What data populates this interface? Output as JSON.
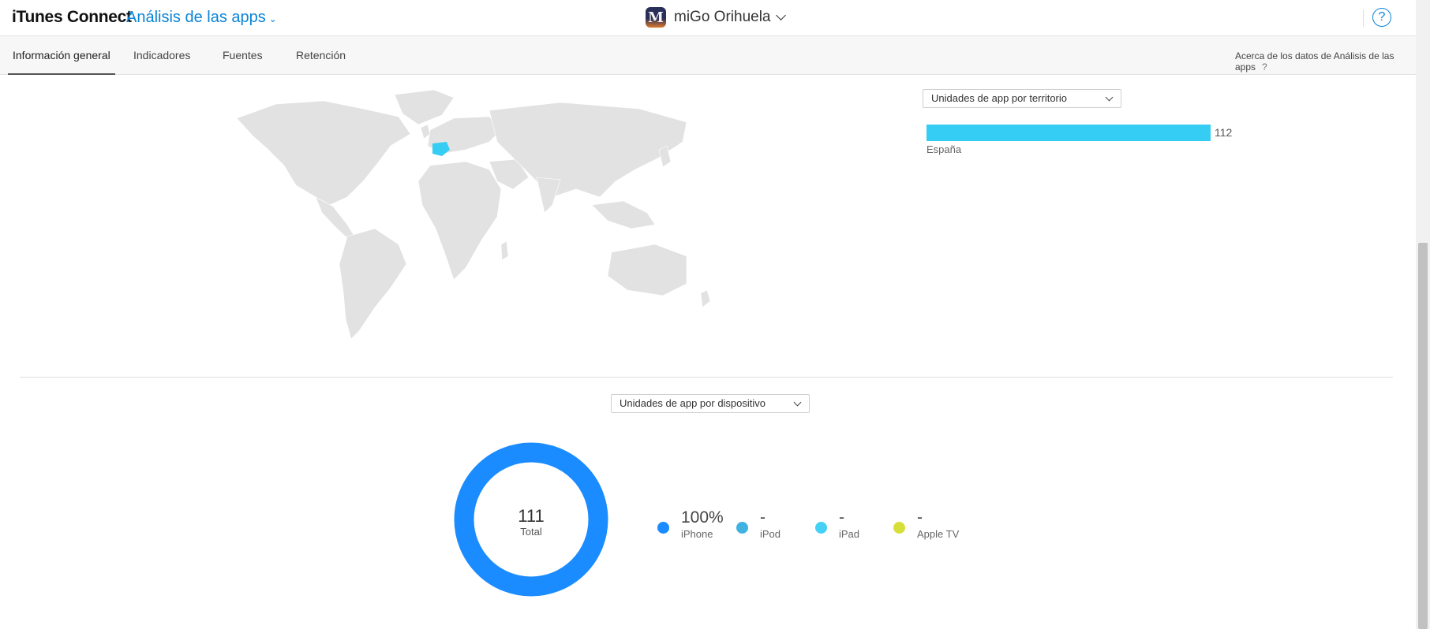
{
  "header": {
    "brand": "iTunes Connect",
    "module": "Análisis de las apps",
    "app_icon_letter": "M",
    "app_name": "miGo Orihuela",
    "help": "?"
  },
  "tabs": [
    {
      "label": "Información general",
      "active": true
    },
    {
      "label": "Indicadores",
      "active": false
    },
    {
      "label": "Fuentes",
      "active": false
    },
    {
      "label": "Retención",
      "active": false
    }
  ],
  "about": {
    "label": "Acerca de los datos de Análisis de las apps",
    "help": "?"
  },
  "territory": {
    "selector": "Unidades de app por territorio",
    "highlight_color": "#35cdf3",
    "land_color": "#e2e2e2",
    "chart_data": {
      "type": "bar",
      "categories": [
        "España"
      ],
      "values": [
        112
      ],
      "xlim": [
        0,
        112
      ]
    }
  },
  "device": {
    "selector": "Unidades de app por dispositivo",
    "total": "111",
    "total_label": "Total",
    "chart_data": {
      "type": "pie",
      "categories": [
        "iPhone",
        "iPod",
        "iPad",
        "Apple TV"
      ],
      "values": [
        100,
        null,
        null,
        null
      ],
      "value_labels": [
        "100%",
        "-",
        "-",
        "-"
      ],
      "colors": [
        "#1a8cff",
        "#3fb2e0",
        "#45d0f5",
        "#d6df3a"
      ]
    }
  }
}
